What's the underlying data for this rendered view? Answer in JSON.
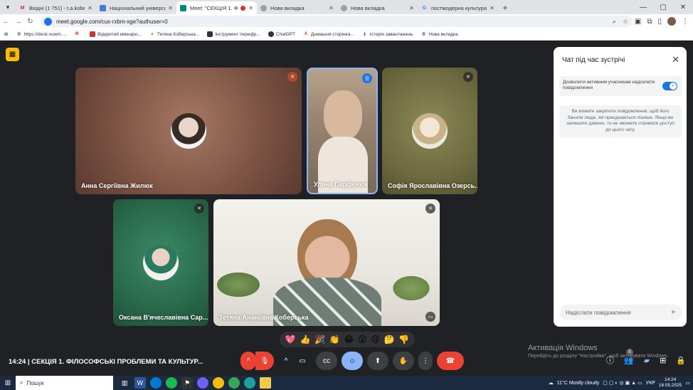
{
  "browser": {
    "tabs": [
      {
        "title": "Вхідні (1 751) - t.a.koberska@...",
        "icon": "gmail-icon",
        "active": false
      },
      {
        "title": "Національний університет вод...",
        "icon": "site-icon",
        "active": false
      },
      {
        "title": "Meet: \"СЕКЦІЯ 1. ФІЛОСОФ...",
        "icon": "meet-icon",
        "active": true,
        "recording": true
      },
      {
        "title": "Нова вкладка",
        "icon": "chrome-icon",
        "active": false
      },
      {
        "title": "Нова вкладка",
        "icon": "chrome-icon",
        "active": false
      },
      {
        "title": "постмодерна культура вка все...",
        "icon": "google-icon",
        "active": false
      }
    ],
    "url": "meet.google.com/cux-rxbm-xge?authuser=0",
    "bookmarks": [
      {
        "label": "https://desk.nuwm...."
      },
      {
        "label": ""
      },
      {
        "label": "Відкритий міжнаро..."
      },
      {
        "label": "Тетяна Коберська..."
      },
      {
        "label": "Інструмент перефр..."
      },
      {
        "label": "ChatGPT"
      },
      {
        "label": "Домашня сторінка..."
      },
      {
        "label": "Історія завантажень"
      },
      {
        "label": "Нова вкладка"
      }
    ]
  },
  "participants": [
    {
      "name": "Анна Сергіївна Жилюк",
      "muted": true,
      "color": "#8a5a48"
    },
    {
      "name": "Уляна Парфенюк",
      "muted": false,
      "speaking": true
    },
    {
      "name": "Софія Ярославівна Озерсь...",
      "muted": true,
      "color": "#7a7a4a"
    },
    {
      "name": "Оксана В'ячеславівна Сар...",
      "muted": true,
      "color": "#2e6e52"
    },
    {
      "name": "Тетяна Ананіївна Коберська",
      "muted": true
    }
  ],
  "chat": {
    "title": "Чат під час зустрічі",
    "toggle_label": "Дозволити активним учасникам надсилати повідомлення",
    "toggle_on": true,
    "info": "Ви можете закріпити повідомлення, щоб його бачили люди, які приєднаються пізніше. Якщо ви залишите дзвінок, то не зможете отримати доступ до цього чату.",
    "input_placeholder": "Надіслати повідомлення"
  },
  "reactions": [
    "💖",
    "👍",
    "🎉",
    "👏",
    "😂",
    "😮",
    "😢",
    "🤔",
    "👎"
  ],
  "meeting": {
    "time": "14:24",
    "title": "СЕКЦІЯ 1. ФІЛОСОФСЬКІ ПРОБЛЕМИ ТА КУЛЬТУР...",
    "people_count": "5"
  },
  "watermark": {
    "line1": "Активація Windows",
    "line2": "Перейдіть до розділу \"Настройки\", щоб активувати Windows."
  },
  "taskbar": {
    "search": "Пошук",
    "weather": "11°C  Mostly cloudy",
    "lang": "УКР",
    "time": "14:24",
    "date": "16.05.2025"
  },
  "colors": {
    "accent": "#1a73e8",
    "hangup": "#ea4335",
    "meet_bg": "#202124"
  }
}
